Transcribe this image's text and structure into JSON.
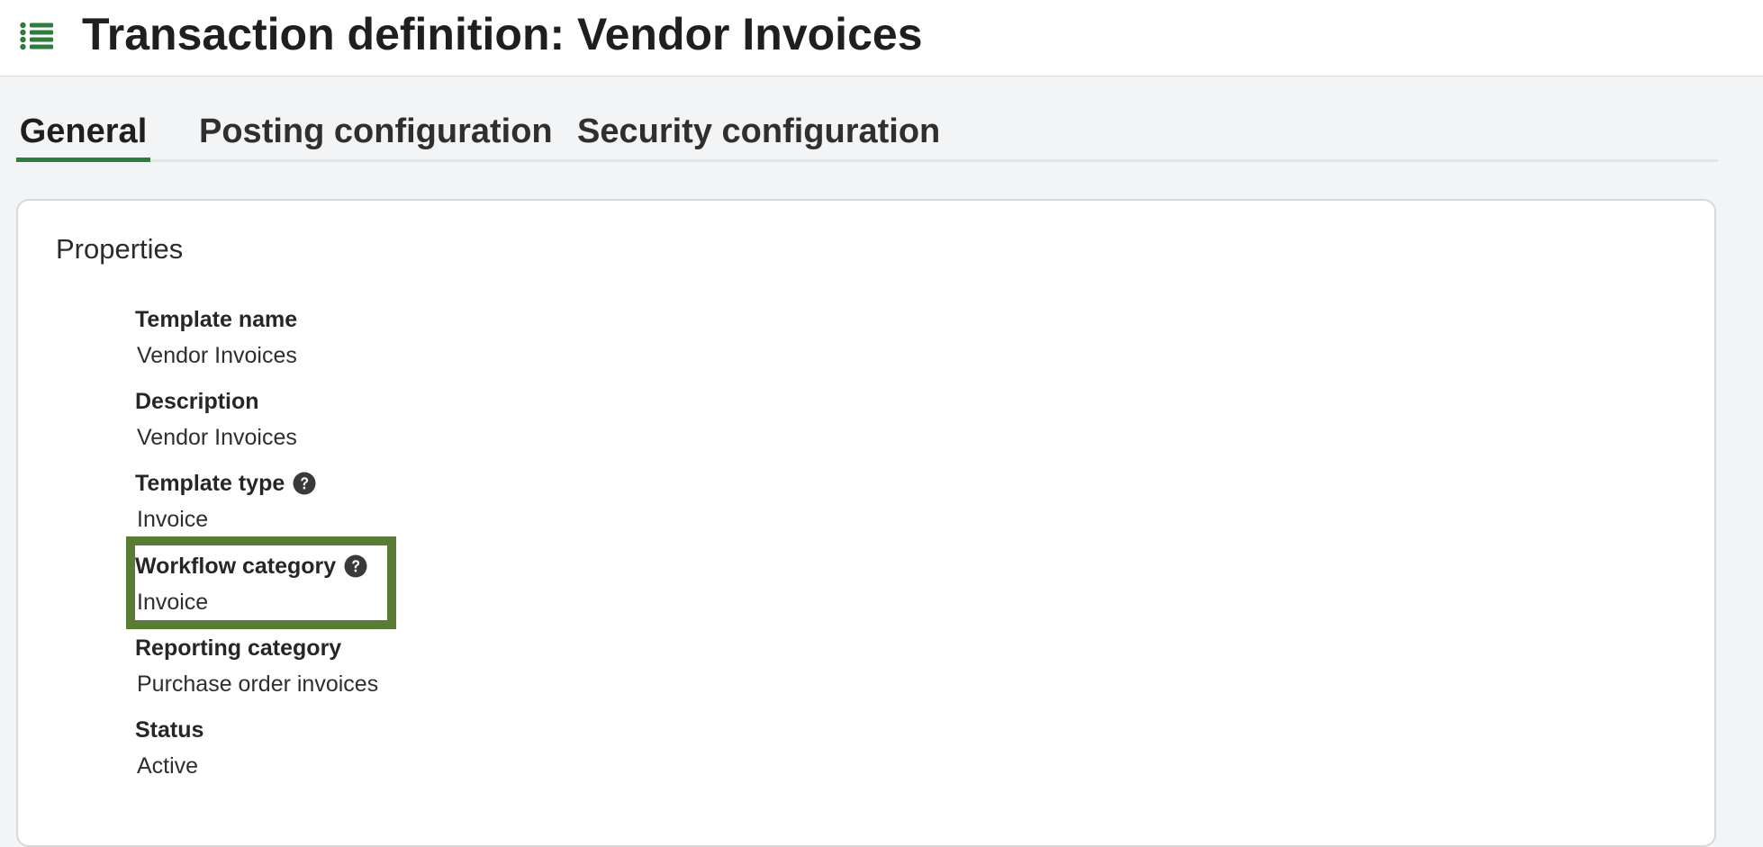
{
  "header": {
    "menu_icon": "list-icon",
    "title": "Transaction definition: Vendor Invoices"
  },
  "tabs": [
    {
      "label": "General",
      "active": true
    },
    {
      "label": "Posting configuration",
      "active": false
    },
    {
      "label": "Security configuration",
      "active": false
    }
  ],
  "properties": {
    "title": "Properties",
    "fields": [
      {
        "label": "Template name",
        "value": "Vendor Invoices",
        "has_help": false
      },
      {
        "label": "Description",
        "value": "Vendor Invoices",
        "has_help": false
      },
      {
        "label": "Template type",
        "value": "Invoice",
        "has_help": true
      },
      {
        "label": "Workflow category",
        "value": "Invoice",
        "has_help": true,
        "highlighted": true
      },
      {
        "label": "Reporting category",
        "value": "Purchase order invoices",
        "has_help": false
      },
      {
        "label": "Status",
        "value": "Active",
        "has_help": false
      }
    ]
  },
  "colors": {
    "accent": "#2e7d3c",
    "highlight": "#587c34",
    "help_icon": "#3a3a3a"
  }
}
